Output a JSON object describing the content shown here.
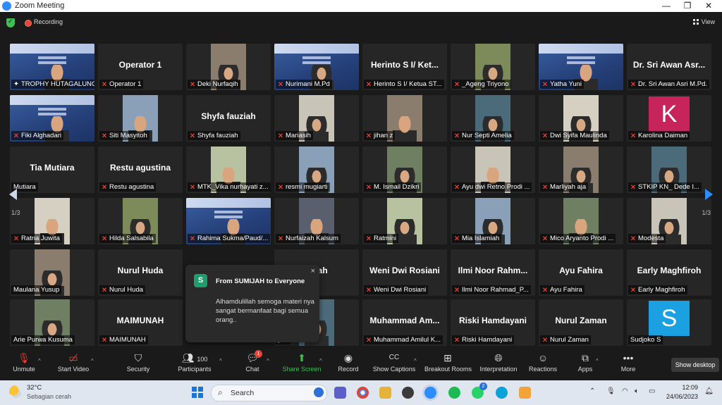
{
  "window": {
    "title": "Zoom Meeting",
    "minimize": "—",
    "maximize": "❐",
    "close": "✕"
  },
  "topbar": {
    "recording": "Recording",
    "view": "View"
  },
  "tiles": [
    {
      "label": "TROPHY HUTAGALUNG",
      "muted": false,
      "type": "slide"
    },
    {
      "name": "Operator 1",
      "label": "Operator 1",
      "muted": true,
      "type": "name"
    },
    {
      "label": "Deki Nurfaqih",
      "muted": true,
      "type": "video"
    },
    {
      "label": "Nurimani M.Pd",
      "muted": true,
      "type": "slide"
    },
    {
      "name": "Herinto S I/ Ket...",
      "label": "Herinto S I/ Ketua ST...",
      "muted": true,
      "type": "name"
    },
    {
      "label": "_Ageng Triyono",
      "muted": true,
      "type": "video"
    },
    {
      "label": "Yatha Yuni",
      "muted": true,
      "type": "slide"
    },
    {
      "name": "Dr. Sri Awan Asr...",
      "label": "Dr. Sri Awan Asri M.Pd.",
      "muted": true,
      "type": "name"
    },
    {
      "label": "Fiki Alghadari",
      "muted": true,
      "type": "slide"
    },
    {
      "label": "Siti Masyitoh",
      "muted": true,
      "type": "video"
    },
    {
      "name": "Shyfa fauziah",
      "label": "Shyfa fauziah",
      "muted": true,
      "type": "name"
    },
    {
      "label": "Mariasih",
      "muted": true,
      "type": "video"
    },
    {
      "label": "jihan z",
      "muted": true,
      "type": "video"
    },
    {
      "label": "Nur Septi Amelia",
      "muted": true,
      "type": "video"
    },
    {
      "label": "Dwi Syifa Maulinda",
      "muted": true,
      "type": "video"
    },
    {
      "letter": "K",
      "label": "Karolina Daiman",
      "muted": true,
      "type": "letter",
      "color": "#c8245c"
    },
    {
      "name": "Tia Mutiara",
      "label": "Mutiara",
      "muted": false,
      "type": "name"
    },
    {
      "name": "Restu agustina",
      "label": "Restu agustina",
      "muted": true,
      "type": "name"
    },
    {
      "label": "MTK_Vika nurhayati z...",
      "muted": true,
      "type": "video"
    },
    {
      "label": "resmi mugiarti",
      "muted": true,
      "type": "video"
    },
    {
      "label": "M. Ismail Dzikri",
      "muted": true,
      "type": "video"
    },
    {
      "label": "Ayu dwi Retno Prodi ...",
      "muted": true,
      "type": "video"
    },
    {
      "label": "Marliyah aja",
      "muted": true,
      "type": "video"
    },
    {
      "label": "STKIP KN_ Dede I...",
      "muted": true,
      "type": "video"
    },
    {
      "label": "Ratna Juwita",
      "muted": true,
      "type": "video"
    },
    {
      "label": "Hilda Salsabila",
      "muted": true,
      "type": "video"
    },
    {
      "label": "Rahima Sukma/Paud/...",
      "muted": true,
      "type": "slide"
    },
    {
      "label": "Nurfaizah Kalsum",
      "muted": true,
      "type": "video"
    },
    {
      "label": "Ratmini",
      "muted": true,
      "type": "video"
    },
    {
      "label": "Mia Islamiah",
      "muted": true,
      "type": "video"
    },
    {
      "label": "Mico Aryanto Prodi ...",
      "muted": true,
      "type": "video"
    },
    {
      "label": "Modesta",
      "muted": true,
      "type": "video"
    },
    {
      "label": "Maulana Yusup",
      "muted": false,
      "type": "video"
    },
    {
      "name": "Nurul Huda",
      "label": "Nurul Huda",
      "muted": true,
      "type": "name"
    },
    {
      "name": "",
      "label": "",
      "muted": false,
      "type": "hidden"
    },
    {
      "name": "nisah",
      "label": "",
      "muted": false,
      "type": "name"
    },
    {
      "name": "Weni Dwi Rosiani",
      "label": "Weni Dwi Rosiani",
      "muted": true,
      "type": "name"
    },
    {
      "name": "Ilmi Noor Rahm...",
      "label": "Ilmi Noor Rahmad_P...",
      "muted": true,
      "type": "name"
    },
    {
      "name": "Ayu Fahira",
      "label": "Ayu Fahira",
      "muted": true,
      "type": "name"
    },
    {
      "name": "Early Maghfiroh",
      "label": "Early Maghfiroh",
      "muted": true,
      "type": "name"
    },
    {
      "label": "Arie Purwa Kusuma",
      "muted": false,
      "type": "video"
    },
    {
      "name": "MAIMUNAH",
      "label": "MAIMUNAH",
      "muted": true,
      "type": "name"
    },
    {
      "name": "",
      "label": "",
      "muted": false,
      "type": "hidden"
    },
    {
      "label": "yah",
      "muted": false,
      "type": "video"
    },
    {
      "name": "Muhammad Am...",
      "label": "Muhammad Amilul K...",
      "muted": true,
      "type": "name"
    },
    {
      "name": "Riski Hamdayani",
      "label": "Riski Hamdayani",
      "muted": true,
      "type": "name"
    },
    {
      "name": "Nurul Zaman",
      "label": "Nurul Zaman",
      "muted": true,
      "type": "name"
    },
    {
      "letter": "S",
      "label": "Sudjoko S",
      "muted": false,
      "type": "letter",
      "color": "#1ba1e2"
    }
  ],
  "pager": {
    "left": "1/3",
    "right": "1/3"
  },
  "chat_popup": {
    "avatar_letter": "S",
    "from": "From SUMIJAH to Everyone",
    "message": "Alhamdulillah semoga materi nya sangat bermanfaat bagi semua orang..",
    "close": "×"
  },
  "toolbar": {
    "unmute": "Unmute",
    "start_video": "Start Video",
    "security": "Security",
    "participants": "Participants",
    "participants_count": "100",
    "chat": "Chat",
    "chat_badge": "1",
    "share": "Share Screen",
    "record": "Record",
    "captions": "Show Captions",
    "breakout": "Breakout Rooms",
    "interpretation": "Interpretation",
    "reactions": "Reactions",
    "apps": "Apps",
    "more": "More",
    "show_desktop": "Show desktop"
  },
  "taskbar": {
    "weather_temp": "32°C",
    "weather_desc": "Sebagian cerah",
    "search": "Search",
    "time": "12:09",
    "date": "24/06/2023",
    "chat_app_badge": "2"
  }
}
